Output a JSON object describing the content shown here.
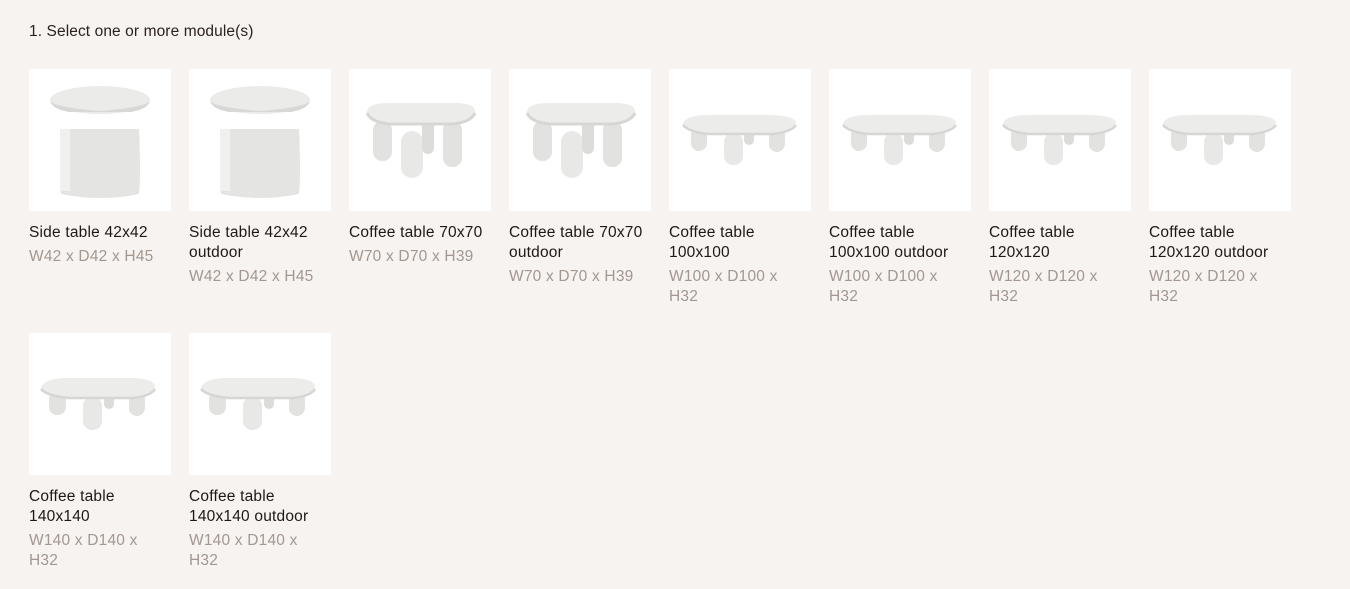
{
  "step": {
    "title": "1. Select one or more module(s)"
  },
  "modules": [
    {
      "name": "Side table 42x42",
      "dims": "W42 x D42 x H45",
      "shape": "side-table-icon"
    },
    {
      "name": "Side table 42x42 outdoor",
      "dims": "W42 x D42 x H45",
      "shape": "side-table-icon"
    },
    {
      "name": "Coffee table 70x70",
      "dims": "W70 x D70 x H39",
      "shape": "coffee-table-tall-icon"
    },
    {
      "name": "Coffee table 70x70 outdoor",
      "dims": "W70 x D70 x H39",
      "shape": "coffee-table-tall-icon"
    },
    {
      "name": "Coffee table 100x100",
      "dims": "W100 x D100 x H32",
      "shape": "coffee-table-low-icon"
    },
    {
      "name": "Coffee table 100x100 outdoor",
      "dims": "W100 x D100 x H32",
      "shape": "coffee-table-low-icon"
    },
    {
      "name": "Coffee table 120x120",
      "dims": "W120 x D120 x H32",
      "shape": "coffee-table-low-icon"
    },
    {
      "name": "Coffee table 120x120 outdoor",
      "dims": "W120 x D120 x H32",
      "shape": "coffee-table-low-icon"
    },
    {
      "name": "Coffee table 140x140",
      "dims": "W140 x D140 x H32",
      "shape": "coffee-table-low-icon"
    },
    {
      "name": "Coffee table 140x140 outdoor",
      "dims": "W140 x D140 x H32",
      "shape": "coffee-table-low-icon"
    }
  ],
  "colors": {
    "background": "#f7f3f0",
    "card": "#ffffff",
    "text": "#1f1814",
    "muted": "#a39790"
  }
}
